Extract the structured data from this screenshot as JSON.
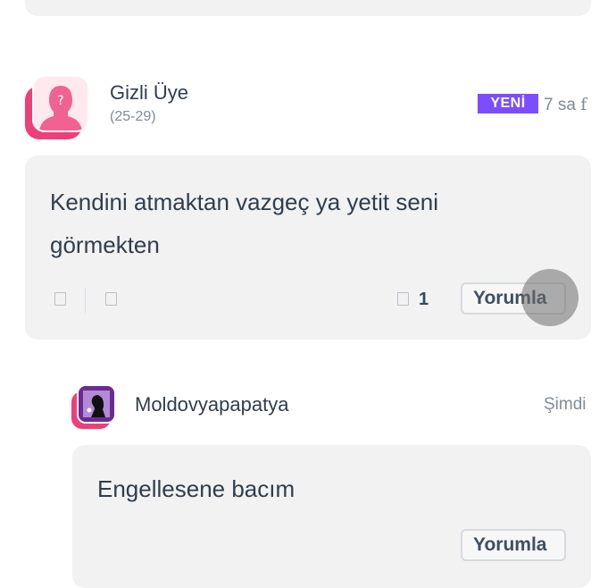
{
  "post": {
    "author": "Gizli Üye",
    "age": "(25-29)",
    "badge": "YENİ",
    "time": "7 sa",
    "body": "Kendini atmaktan vazgeç ya yetit seni görmekten",
    "comment_count": "1",
    "reply_button": "Yorumla"
  },
  "reply": {
    "author": "Moldovyapapatya",
    "time": "Şimdi",
    "body": "Engellesene bacım",
    "reply_button": "Yorumla"
  },
  "colors": {
    "badge": "#7c4dff",
    "avatar_shadow": "#ec407a"
  }
}
